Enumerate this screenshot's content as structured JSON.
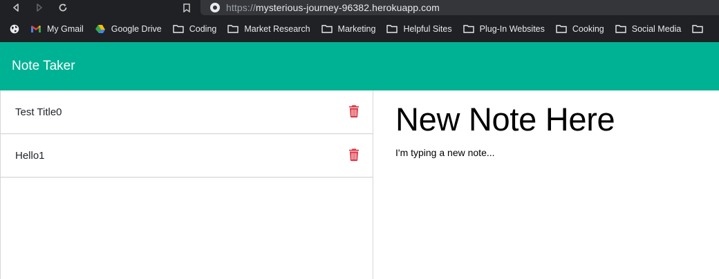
{
  "browser": {
    "url_scheme": "https://",
    "url_host": "mysterious-journey-96382.herokuapp.com",
    "bookmarks": [
      {
        "label": "My Gmail",
        "icon": "gmail-icon"
      },
      {
        "label": "Google Drive",
        "icon": "google-drive-icon"
      },
      {
        "label": "Coding",
        "icon": "folder-icon"
      },
      {
        "label": "Market Research",
        "icon": "folder-icon"
      },
      {
        "label": "Marketing",
        "icon": "folder-icon"
      },
      {
        "label": "Helpful Sites",
        "icon": "folder-icon"
      },
      {
        "label": "Plug-In Websites",
        "icon": "folder-icon"
      },
      {
        "label": "Cooking",
        "icon": "folder-icon"
      },
      {
        "label": "Social Media",
        "icon": "folder-icon"
      }
    ]
  },
  "app": {
    "brand": "Note Taker",
    "accent_color": "#00b294",
    "delete_color": "#dc3545"
  },
  "notes": [
    {
      "title": "Test Title0"
    },
    {
      "title": "Hello1"
    }
  ],
  "editor": {
    "title": "New Note Here",
    "text": "I'm typing a new note..."
  }
}
